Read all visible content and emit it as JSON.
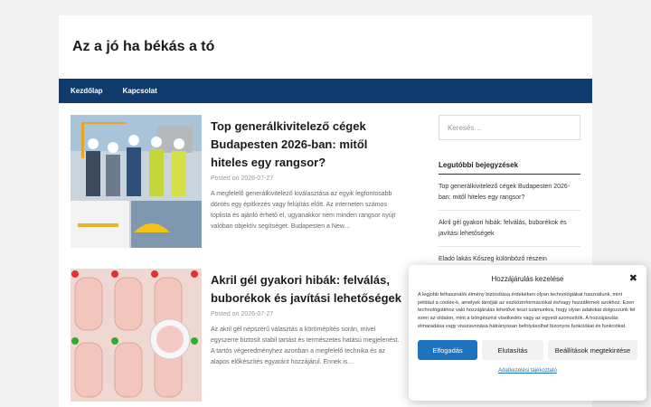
{
  "site": {
    "title": "Az a jó ha békás a tó"
  },
  "nav": {
    "items": [
      "Kezdőlap",
      "Kapcsolat"
    ]
  },
  "posts": [
    {
      "title": "Top generálkivitelező cégek Budapesten 2026-ban: mitől hiteles egy rangsor?",
      "meta": "Posted on 2026-07-27",
      "excerpt": "A megfelelő generálkivitelező kiválasztása az egyik legfontosabb döntés egy építkezés vagy felújítás előtt. Az interneten számos toplista és ajánló érhető el, ugyanakkor nem minden rangsor nyújt valóban objektív segítséget. Budapesten a New…"
    },
    {
      "title": "Akril gél gyakori hibák: felválás, buborékok és javítási lehetőségek",
      "meta": "Posted on 2026-07-27",
      "excerpt": "Az akril gél népszerű választás a körömépítés során, mivel egyszerre biztosít stabil tartást és természetes hatású megjelenést. A tartós végeredményhez azonban a megfelelő technika és az alapos előkészítés egyaránt hozzájárul. Ennek is…"
    }
  ],
  "sidebar": {
    "search_placeholder": "Keresés…",
    "recent_title": "Legutóbbi bejegyzések",
    "recent_items": [
      "Top generálkivitelező cégek Budapesten 2026-ban: mitől hiteles egy rangsor?",
      "Akril gél gyakori hibák: felválás, buborékok és javítási lehetőségek",
      "Eladó lakás Kőszeg különböző részein"
    ]
  },
  "cookie": {
    "title": "Hozzájárulás kezelése",
    "close": "✖",
    "text": "A legjobb felhasználói élmény biztosítása érdekében olyan technológiákat használunk, mint például a cookie-k, amelyek tárolják az eszközinformációkat és/vagy hozzáférnek azokhoz. Ezen technológiákhoz való hozzájárulás lehetővé teszi számunkra, hogy olyan adatokat dolgozzunk fel ezen az oldalon, mint a böngészési viselkedés vagy az egyedi azonosítók. A hozzájárulás elmaradása vagy visszavonása hátrányosan befolyásolhat bizonyos funkciókat és funkciókat.",
    "accept": "Elfogadás",
    "deny": "Elutasítás",
    "settings": "Beállítások megtekintése",
    "privacy_link": "Adatkezelési tájékoztató"
  },
  "colors": {
    "nav_bg": "#0f3a6d",
    "accent": "#1e73be"
  }
}
